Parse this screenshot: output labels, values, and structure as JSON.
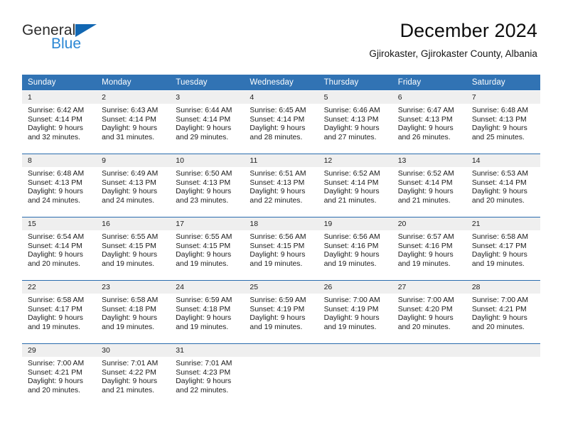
{
  "brand": {
    "name_line1": "General",
    "name_line2": "Blue",
    "accent_color": "#2b87d4",
    "triangle_color": "#1267b2"
  },
  "header": {
    "title": "December 2024",
    "location": "Gjirokaster, Gjirokaster County, Albania"
  },
  "calendar": {
    "header_bg": "#3173b4",
    "row_border_color": "#2a6cae",
    "day_band_bg": "#efefef",
    "weekdays": [
      "Sunday",
      "Monday",
      "Tuesday",
      "Wednesday",
      "Thursday",
      "Friday",
      "Saturday"
    ],
    "weeks": [
      [
        {
          "day": "1",
          "sunrise": "Sunrise: 6:42 AM",
          "sunset": "Sunset: 4:14 PM",
          "daylight1": "Daylight: 9 hours",
          "daylight2": "and 32 minutes."
        },
        {
          "day": "2",
          "sunrise": "Sunrise: 6:43 AM",
          "sunset": "Sunset: 4:14 PM",
          "daylight1": "Daylight: 9 hours",
          "daylight2": "and 31 minutes."
        },
        {
          "day": "3",
          "sunrise": "Sunrise: 6:44 AM",
          "sunset": "Sunset: 4:14 PM",
          "daylight1": "Daylight: 9 hours",
          "daylight2": "and 29 minutes."
        },
        {
          "day": "4",
          "sunrise": "Sunrise: 6:45 AM",
          "sunset": "Sunset: 4:14 PM",
          "daylight1": "Daylight: 9 hours",
          "daylight2": "and 28 minutes."
        },
        {
          "day": "5",
          "sunrise": "Sunrise: 6:46 AM",
          "sunset": "Sunset: 4:13 PM",
          "daylight1": "Daylight: 9 hours",
          "daylight2": "and 27 minutes."
        },
        {
          "day": "6",
          "sunrise": "Sunrise: 6:47 AM",
          "sunset": "Sunset: 4:13 PM",
          "daylight1": "Daylight: 9 hours",
          "daylight2": "and 26 minutes."
        },
        {
          "day": "7",
          "sunrise": "Sunrise: 6:48 AM",
          "sunset": "Sunset: 4:13 PM",
          "daylight1": "Daylight: 9 hours",
          "daylight2": "and 25 minutes."
        }
      ],
      [
        {
          "day": "8",
          "sunrise": "Sunrise: 6:48 AM",
          "sunset": "Sunset: 4:13 PM",
          "daylight1": "Daylight: 9 hours",
          "daylight2": "and 24 minutes."
        },
        {
          "day": "9",
          "sunrise": "Sunrise: 6:49 AM",
          "sunset": "Sunset: 4:13 PM",
          "daylight1": "Daylight: 9 hours",
          "daylight2": "and 24 minutes."
        },
        {
          "day": "10",
          "sunrise": "Sunrise: 6:50 AM",
          "sunset": "Sunset: 4:13 PM",
          "daylight1": "Daylight: 9 hours",
          "daylight2": "and 23 minutes."
        },
        {
          "day": "11",
          "sunrise": "Sunrise: 6:51 AM",
          "sunset": "Sunset: 4:13 PM",
          "daylight1": "Daylight: 9 hours",
          "daylight2": "and 22 minutes."
        },
        {
          "day": "12",
          "sunrise": "Sunrise: 6:52 AM",
          "sunset": "Sunset: 4:14 PM",
          "daylight1": "Daylight: 9 hours",
          "daylight2": "and 21 minutes."
        },
        {
          "day": "13",
          "sunrise": "Sunrise: 6:52 AM",
          "sunset": "Sunset: 4:14 PM",
          "daylight1": "Daylight: 9 hours",
          "daylight2": "and 21 minutes."
        },
        {
          "day": "14",
          "sunrise": "Sunrise: 6:53 AM",
          "sunset": "Sunset: 4:14 PM",
          "daylight1": "Daylight: 9 hours",
          "daylight2": "and 20 minutes."
        }
      ],
      [
        {
          "day": "15",
          "sunrise": "Sunrise: 6:54 AM",
          "sunset": "Sunset: 4:14 PM",
          "daylight1": "Daylight: 9 hours",
          "daylight2": "and 20 minutes."
        },
        {
          "day": "16",
          "sunrise": "Sunrise: 6:55 AM",
          "sunset": "Sunset: 4:15 PM",
          "daylight1": "Daylight: 9 hours",
          "daylight2": "and 19 minutes."
        },
        {
          "day": "17",
          "sunrise": "Sunrise: 6:55 AM",
          "sunset": "Sunset: 4:15 PM",
          "daylight1": "Daylight: 9 hours",
          "daylight2": "and 19 minutes."
        },
        {
          "day": "18",
          "sunrise": "Sunrise: 6:56 AM",
          "sunset": "Sunset: 4:15 PM",
          "daylight1": "Daylight: 9 hours",
          "daylight2": "and 19 minutes."
        },
        {
          "day": "19",
          "sunrise": "Sunrise: 6:56 AM",
          "sunset": "Sunset: 4:16 PM",
          "daylight1": "Daylight: 9 hours",
          "daylight2": "and 19 minutes."
        },
        {
          "day": "20",
          "sunrise": "Sunrise: 6:57 AM",
          "sunset": "Sunset: 4:16 PM",
          "daylight1": "Daylight: 9 hours",
          "daylight2": "and 19 minutes."
        },
        {
          "day": "21",
          "sunrise": "Sunrise: 6:58 AM",
          "sunset": "Sunset: 4:17 PM",
          "daylight1": "Daylight: 9 hours",
          "daylight2": "and 19 minutes."
        }
      ],
      [
        {
          "day": "22",
          "sunrise": "Sunrise: 6:58 AM",
          "sunset": "Sunset: 4:17 PM",
          "daylight1": "Daylight: 9 hours",
          "daylight2": "and 19 minutes."
        },
        {
          "day": "23",
          "sunrise": "Sunrise: 6:58 AM",
          "sunset": "Sunset: 4:18 PM",
          "daylight1": "Daylight: 9 hours",
          "daylight2": "and 19 minutes."
        },
        {
          "day": "24",
          "sunrise": "Sunrise: 6:59 AM",
          "sunset": "Sunset: 4:18 PM",
          "daylight1": "Daylight: 9 hours",
          "daylight2": "and 19 minutes."
        },
        {
          "day": "25",
          "sunrise": "Sunrise: 6:59 AM",
          "sunset": "Sunset: 4:19 PM",
          "daylight1": "Daylight: 9 hours",
          "daylight2": "and 19 minutes."
        },
        {
          "day": "26",
          "sunrise": "Sunrise: 7:00 AM",
          "sunset": "Sunset: 4:19 PM",
          "daylight1": "Daylight: 9 hours",
          "daylight2": "and 19 minutes."
        },
        {
          "day": "27",
          "sunrise": "Sunrise: 7:00 AM",
          "sunset": "Sunset: 4:20 PM",
          "daylight1": "Daylight: 9 hours",
          "daylight2": "and 20 minutes."
        },
        {
          "day": "28",
          "sunrise": "Sunrise: 7:00 AM",
          "sunset": "Sunset: 4:21 PM",
          "daylight1": "Daylight: 9 hours",
          "daylight2": "and 20 minutes."
        }
      ],
      [
        {
          "day": "29",
          "sunrise": "Sunrise: 7:00 AM",
          "sunset": "Sunset: 4:21 PM",
          "daylight1": "Daylight: 9 hours",
          "daylight2": "and 20 minutes."
        },
        {
          "day": "30",
          "sunrise": "Sunrise: 7:01 AM",
          "sunset": "Sunset: 4:22 PM",
          "daylight1": "Daylight: 9 hours",
          "daylight2": "and 21 minutes."
        },
        {
          "day": "31",
          "sunrise": "Sunrise: 7:01 AM",
          "sunset": "Sunset: 4:23 PM",
          "daylight1": "Daylight: 9 hours",
          "daylight2": "and 22 minutes."
        },
        {
          "day": "",
          "sunrise": "",
          "sunset": "",
          "daylight1": "",
          "daylight2": ""
        },
        {
          "day": "",
          "sunrise": "",
          "sunset": "",
          "daylight1": "",
          "daylight2": ""
        },
        {
          "day": "",
          "sunrise": "",
          "sunset": "",
          "daylight1": "",
          "daylight2": ""
        },
        {
          "day": "",
          "sunrise": "",
          "sunset": "",
          "daylight1": "",
          "daylight2": ""
        }
      ]
    ]
  }
}
